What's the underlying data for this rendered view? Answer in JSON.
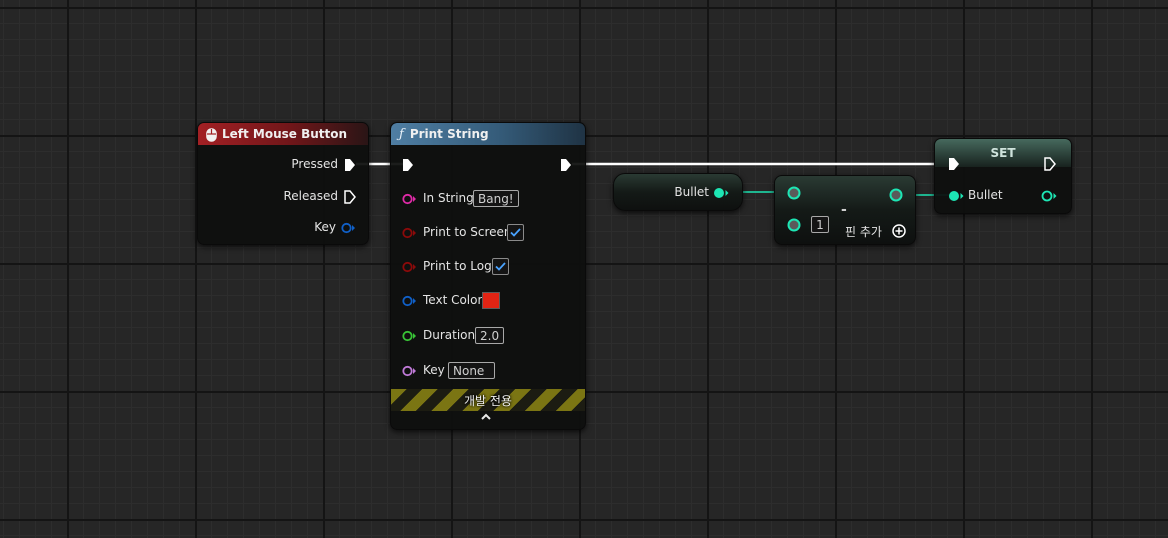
{
  "colors": {
    "exec": "#ffffff",
    "object_pin": "#1de6b4",
    "string_pin": "#e02aa8",
    "bool_pin": "#8c0a0a",
    "struct_pin": "#1060c8",
    "float_pin": "#38c436",
    "key_pin": "#c07ad8",
    "text_color_swatch": "#e12414",
    "checkmark": "#4aa3ff"
  },
  "nodes": {
    "left_mouse_button": {
      "title": "Left Mouse Button",
      "icon": "mouse-icon",
      "pins": {
        "pressed": "Pressed",
        "released": "Released",
        "key": "Key"
      }
    },
    "print_string": {
      "title": "Print String",
      "icon_glyph": "ƒ",
      "pins": {
        "in_string": {
          "label": "In String",
          "value": "Bang!"
        },
        "print_to_screen": {
          "label": "Print to Screen",
          "checked": true
        },
        "print_to_log": {
          "label": "Print to Log",
          "checked": true
        },
        "text_color": {
          "label": "Text Color"
        },
        "duration": {
          "label": "Duration",
          "value": "2.0"
        },
        "key": {
          "label": "Key",
          "value": "None"
        }
      },
      "dev_only_label": "개발 전용",
      "collapse_icon": "chevron-up-icon"
    },
    "bullet_get": {
      "label": "Bullet"
    },
    "subtract": {
      "operator": "-",
      "input_value": "1",
      "add_pin_label": "핀 추가",
      "add_pin_icon": "plus-circle-icon"
    },
    "set": {
      "title": "SET",
      "pin_label": "Bullet"
    }
  }
}
